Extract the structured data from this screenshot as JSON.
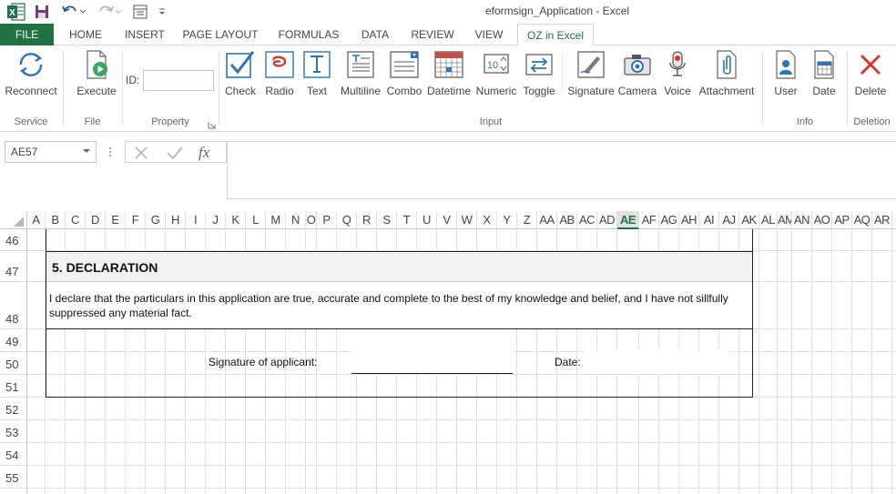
{
  "app": {
    "title": "eformsign_Application - Excel",
    "excel_icon_letter": "X",
    "accent_color": "#217346"
  },
  "tabs": [
    {
      "label": "FILE"
    },
    {
      "label": "HOME"
    },
    {
      "label": "INSERT"
    },
    {
      "label": "PAGE LAYOUT"
    },
    {
      "label": "FORMULAS"
    },
    {
      "label": "DATA"
    },
    {
      "label": "REVIEW"
    },
    {
      "label": "VIEW"
    },
    {
      "label": "OZ in Excel"
    }
  ],
  "active_tab": "OZ in Excel",
  "ribbon": {
    "service": {
      "group": "Service",
      "reconnect": "Reconnect"
    },
    "file": {
      "group": "File",
      "execute": "Execute"
    },
    "property": {
      "group": "Property",
      "id_label": "ID:",
      "id_value": ""
    },
    "input": {
      "group": "Input",
      "buttons": [
        "Check",
        "Radio",
        "Text",
        "Multiline",
        "Combo",
        "Datetime",
        "Numeric",
        "Toggle",
        "Signature",
        "Camera",
        "Voice",
        "Attachment"
      ]
    },
    "info": {
      "group": "Info",
      "buttons": [
        "User",
        "Date"
      ]
    },
    "deletion": {
      "group": "Deletion",
      "delete": "Delete"
    }
  },
  "formula_bar": {
    "name_box": "AE57",
    "fx_label": "fx",
    "formula": ""
  },
  "grid": {
    "columns": [
      "A",
      "B",
      "C",
      "D",
      "E",
      "F",
      "G",
      "H",
      "I",
      "J",
      "K",
      "L",
      "M",
      "N",
      "O",
      "P",
      "Q",
      "R",
      "S",
      "T",
      "U",
      "V",
      "W",
      "X",
      "Y",
      "Z",
      "AA",
      "AB",
      "AC",
      "AD",
      "AE",
      "AF",
      "AG",
      "AH",
      "AI",
      "AJ",
      "AK",
      "AL",
      "AM",
      "AN",
      "AO",
      "AP",
      "AQ",
      "AR"
    ],
    "selected_column": "AE",
    "rows": [
      "46",
      "47",
      "48",
      "49",
      "50",
      "51",
      "52",
      "53",
      "54",
      "55"
    ]
  },
  "form": {
    "section_title": "5. DECLARATION",
    "declaration_line1": "I declare that the particulars in this application are true, accurate and complete to the best of my knowledge and belief, and I have not sillfully",
    "declaration_line2": "suppressed any material fact.",
    "signature_label": "Signature of applicant:",
    "date_label": "Date:"
  }
}
